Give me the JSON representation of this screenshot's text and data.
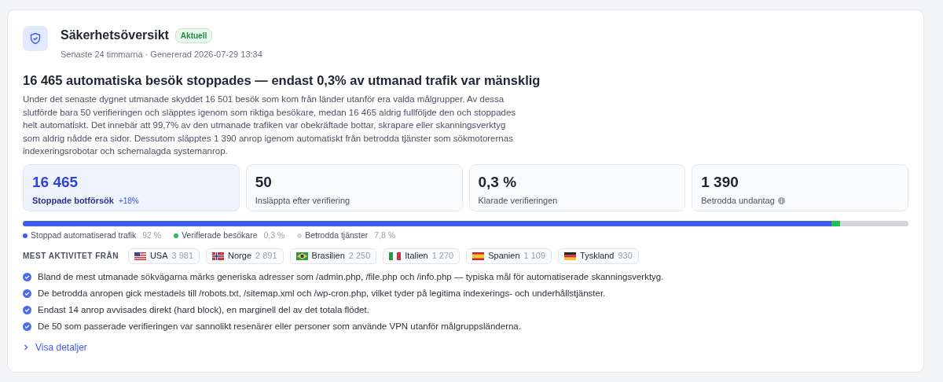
{
  "header": {
    "title": "Säkerhetsöversikt",
    "badge": "Aktuell",
    "subtitle": "Senaste 24 timmarna · Genererad 2026-07-29 13:34"
  },
  "headline": "16 465 automatiska besök stoppades — endast 0,3% av utmanad trafik var mänsklig",
  "summary": "Under det senaste dygnet utmanade skyddet 16 501 besök som kom från länder utanför era valda målgrupper. Av dessa slutförde bara 50 verifieringen och släpptes igenom som riktiga besökare, medan 16 465 aldrig fullföljde den och stoppades helt automatiskt. Det innebär att 99,7% av den utmanade trafiken var obekräftade bottar, skrapare eller skanningsverktyg som aldrig nådde era sidor. Dessutom släpptes 1 390 anrop igenom automatiskt från betrodda tjänster som sökmotorernas indexeringsrobotar och schemalagda systemanrop.",
  "stats": [
    {
      "value": "16 465",
      "label": "Stoppade botförsök",
      "delta": "+18%",
      "selected": true,
      "info": false
    },
    {
      "value": "50",
      "label": "Insläppta efter verifiering",
      "selected": false,
      "info": false
    },
    {
      "value": "0,3 %",
      "label": "Klarade verifieringen",
      "selected": false,
      "info": false
    },
    {
      "value": "1 390",
      "label": "Betrodda undantag",
      "selected": false,
      "info": true
    }
  ],
  "distribution": [
    {
      "label": "Stoppad automatiserad trafik",
      "share": "92 %",
      "color": "#3d5af1",
      "level": 0.913
    },
    {
      "label": "Verifierade besökare",
      "share": "0,3 %",
      "color": "#1ec05a"
    },
    {
      "label": "Betrodda tjänster",
      "share": "7,8 %",
      "color": "#d4d6d9",
      "level": 0.077
    }
  ],
  "countries": {
    "heading": "MEST AKTIVITET FRÅN",
    "items": [
      {
        "kind": "usa",
        "name": "USA",
        "count": "3 981"
      },
      {
        "kind": "norway",
        "name": "Norge",
        "count": "2 891"
      },
      {
        "kind": "brazil",
        "name": "Brasilien",
        "count": "2 250"
      },
      {
        "kind": "italy",
        "name": "Italien",
        "count": "1 270"
      },
      {
        "kind": "spain",
        "name": "Spanien",
        "count": "1 109"
      },
      {
        "kind": "germany",
        "name": "Tyskland",
        "count": "930"
      }
    ]
  },
  "findings": [
    "Bland de mest utmanade sökvägarna märks generiska adresser som /admin.php, /file.php och /info.php — typiska mål för automatiserade skanningsverktyg.",
    "De betrodda anropen gick mestadels till /robots.txt, /sitemap.xml och /wp-cron.php, vilket tyder på legitima indexerings- och underhållstjänster.",
    "Endast 14 anrop avvisades direkt (hard block), en marginell del av det totala flödet.",
    "De 50 som passerade verifieringen var sannolikt resenärer eller personer som använde VPN utanför målgruppsländerna."
  ],
  "details_link": {
    "label": "Visa detaljer"
  }
}
